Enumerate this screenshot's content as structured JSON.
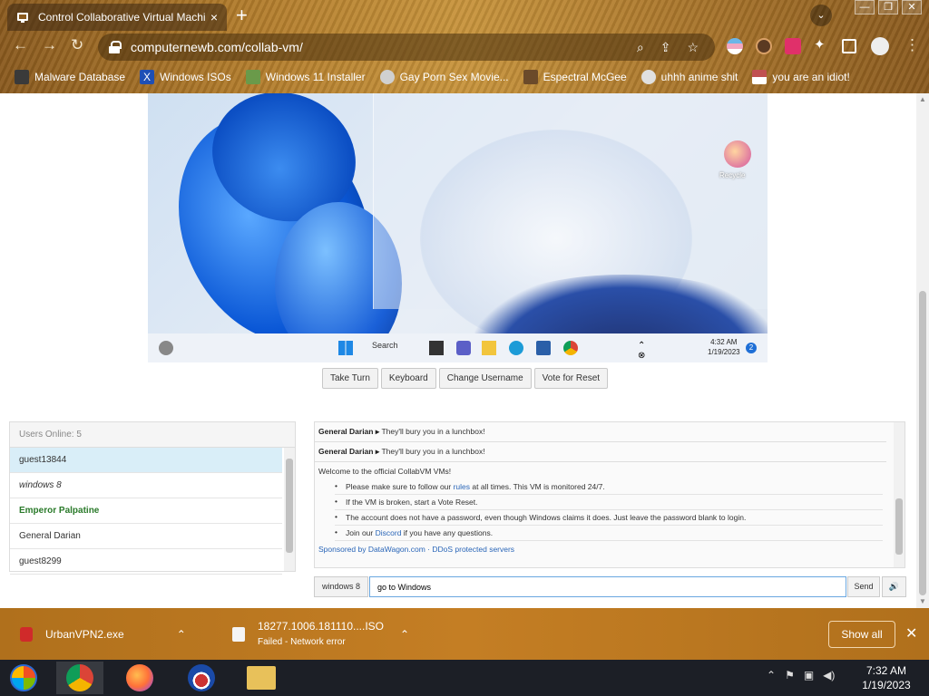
{
  "browser": {
    "tab_title": "Control Collaborative Virtual Machine",
    "tab_close": "×",
    "new_tab": "+",
    "url": "computernewb.com/collab-vm/",
    "window_buttons": [
      "—",
      "❐",
      "✕"
    ]
  },
  "bookmarks": [
    {
      "label": "Malware Database",
      "color": "#3a3a3a"
    },
    {
      "label": "Windows ISOs",
      "color": "#1e4fb5"
    },
    {
      "label": "Windows 11 Installer",
      "color": "#6a9a4a"
    },
    {
      "label": "Gay Porn Sex Movie...",
      "color": "#d0d0d0"
    },
    {
      "label": "Espectral McGee",
      "color": "#6b4a2a"
    },
    {
      "label": "uhhh anime shit",
      "color": "#e0e0e0"
    },
    {
      "label": "you are an idiot!",
      "color": "#c05050"
    }
  ],
  "vm": {
    "search_label": "Search",
    "clock_time": "4:32 AM",
    "clock_date": "1/19/2023",
    "badge": "2",
    "desktop_icon_label": "Recycle"
  },
  "vm_controls": {
    "take_turn": "Take Turn",
    "keyboard": "Keyboard",
    "change_username": "Change Username",
    "vote_reset": "Vote for Reset"
  },
  "users": {
    "header": "Users Online: 5",
    "list": [
      "guest13844",
      "windows 8",
      "Emperor Palpatine",
      "General Darian",
      "guest8299"
    ]
  },
  "chat": {
    "messages": [
      {
        "user": "General Darian",
        "text": "They'll bury you in a lunchbox!"
      },
      {
        "user": "General Darian",
        "text": "They'll bury you in a lunchbox!"
      }
    ],
    "welcome": "Welcome to the official CollabVM VMs!",
    "rules": [
      {
        "pre": "Please make sure to follow our ",
        "link": "rules",
        "post": " at all times. This VM is monitored 24/7."
      },
      {
        "pre": "If the VM is broken, start a Vote Reset.",
        "link": "",
        "post": ""
      },
      {
        "pre": "The account does not have a password, even though Windows claims it does. Just leave the password blank to login.",
        "link": "",
        "post": ""
      },
      {
        "pre": "Join our ",
        "link": "Discord",
        "post": " if you have any questions."
      }
    ],
    "sponsor": "Sponsored by DataWagon.com · DDoS protected servers"
  },
  "chat_input": {
    "username": "windows 8",
    "value": "go to Windows",
    "send_label": "Send",
    "volume_label": "🔊"
  },
  "downloads": [
    {
      "name": "UrbanVPN2.exe",
      "status": ""
    },
    {
      "name": "18277.1006.181110....ISO",
      "status": "Failed - Network error"
    }
  ],
  "downloads_show_all": "Show all",
  "taskbar": {
    "time": "7:32 AM",
    "date": "1/19/2023"
  }
}
